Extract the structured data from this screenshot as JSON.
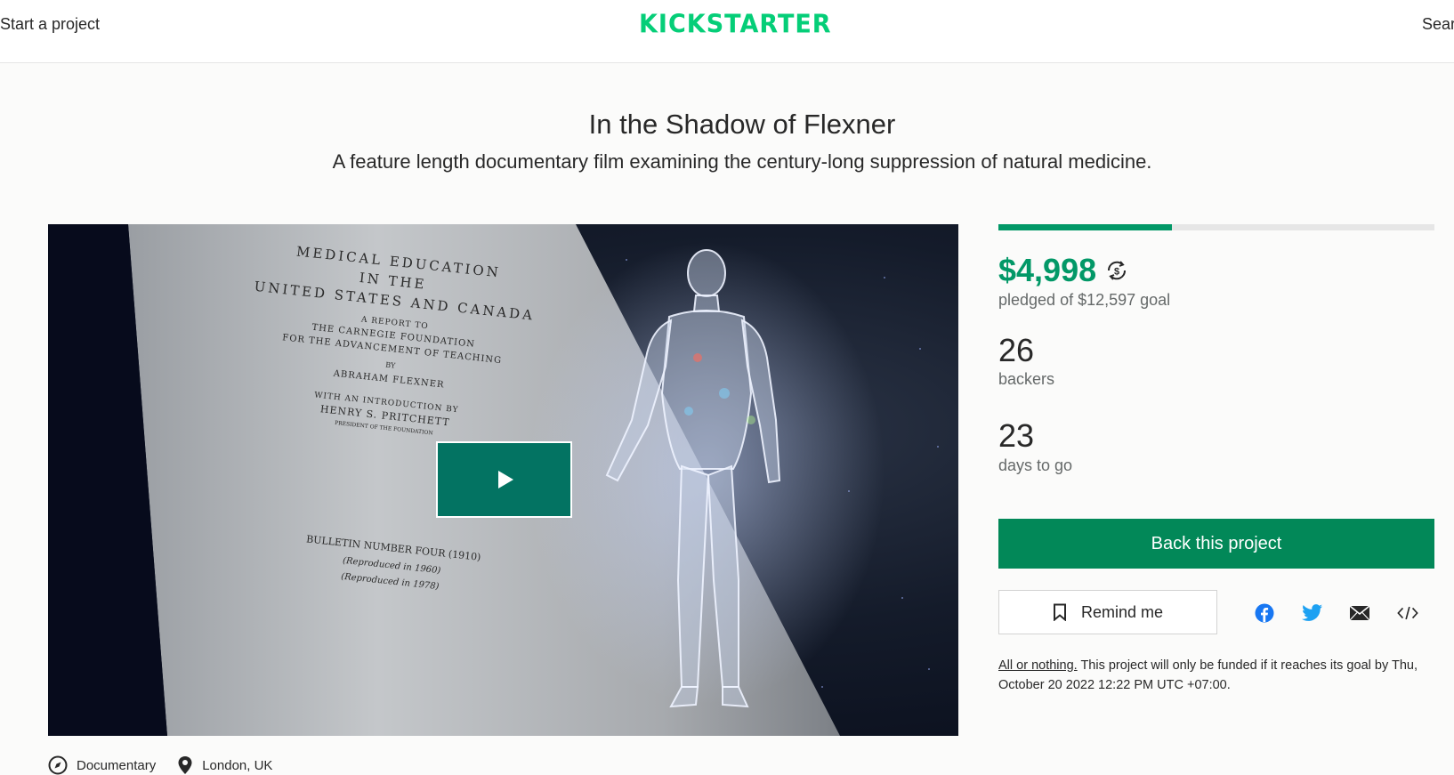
{
  "header": {
    "start_project": "Start a project",
    "logo": "KICKSTARTER",
    "search": "Sear"
  },
  "project": {
    "title": "In the Shadow of Flexner",
    "blurb": "A feature length documentary film examining the century-long suppression of natural medicine."
  },
  "video": {
    "book_lines": {
      "l1": "MEDICAL EDUCATION",
      "l2": "IN THE",
      "l3": "UNITED STATES AND CANADA",
      "l4": "A REPORT TO",
      "l5": "THE CARNEGIE FOUNDATION",
      "l6": "FOR THE ADVANCEMENT OF TEACHING",
      "l7": "BY",
      "l8": "ABRAHAM FLEXNER",
      "l9": "WITH AN INTRODUCTION BY",
      "l10": "HENRY S. PRITCHETT",
      "l11": "PRESIDENT OF THE FOUNDATION",
      "l12": "BULLETIN NUMBER FOUR (1910)",
      "l13": "(Reproduced in 1960)",
      "l14": "(Reproduced in 1978)"
    },
    "play_icon": "play-icon"
  },
  "meta": {
    "category": "Documentary",
    "location": "London, UK"
  },
  "stats": {
    "funded_fraction": 0.397,
    "pledged": "$4,998",
    "pledged_label": "pledged of $12,597 goal",
    "backers": "26",
    "backers_label": "backers",
    "days": "23",
    "days_label": "days to go"
  },
  "actions": {
    "back": "Back this project",
    "remind": "Remind me"
  },
  "share_icons": [
    "facebook-icon",
    "twitter-icon",
    "email-icon",
    "embed-icon"
  ],
  "fine_print": {
    "link": "All or nothing.",
    "text": " This project will only be funded if it reaches its goal by Thu, October 20 2022 12:22 PM UTC +07:00."
  },
  "colors": {
    "brand": "#05ce78",
    "primary": "#028858",
    "progress": "#029867",
    "play": "#037362",
    "facebook": "#1877f2",
    "twitter": "#1da1f2"
  }
}
